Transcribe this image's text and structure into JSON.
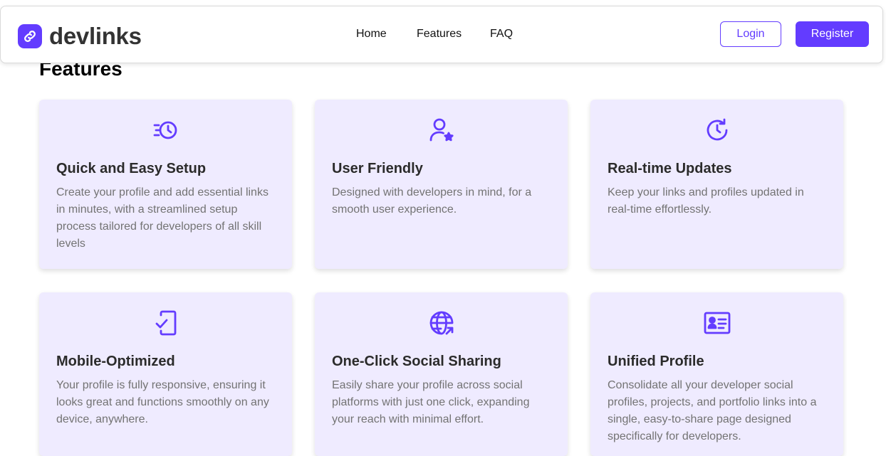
{
  "brand": {
    "name": "devlinks",
    "accent_color": "#633cff"
  },
  "nav": {
    "links": [
      "Home",
      "Features",
      "FAQ"
    ]
  },
  "auth": {
    "login_label": "Login",
    "register_label": "Register"
  },
  "section": {
    "title": "Features"
  },
  "cards": [
    {
      "icon": "clock-fast-icon",
      "title": "Quick and Easy Setup",
      "description": "Create your profile and add essential links in minutes, with a streamlined setup process tailored for developers of all skill levels"
    },
    {
      "icon": "user-star-icon",
      "title": "User Friendly",
      "description": "Designed with developers in mind, for a smooth user experience."
    },
    {
      "icon": "refresh-clock-icon",
      "title": "Real-time Updates",
      "description": "Keep your links and profiles updated in real-time effortlessly."
    },
    {
      "icon": "mobile-check-icon",
      "title": "Mobile-Optimized",
      "description": "Your profile is fully responsive, ensuring it looks great and functions smoothly on any device, anywhere."
    },
    {
      "icon": "globe-share-icon",
      "title": "One-Click Social Sharing",
      "description": "Easily share your profile across social platforms with just one click, expanding your reach with minimal effort."
    },
    {
      "icon": "id-card-icon",
      "title": "Unified Profile",
      "description": "Consolidate all your developer social profiles, projects, and portfolio links into a single, easy-to-share page designed specifically for developers."
    }
  ]
}
